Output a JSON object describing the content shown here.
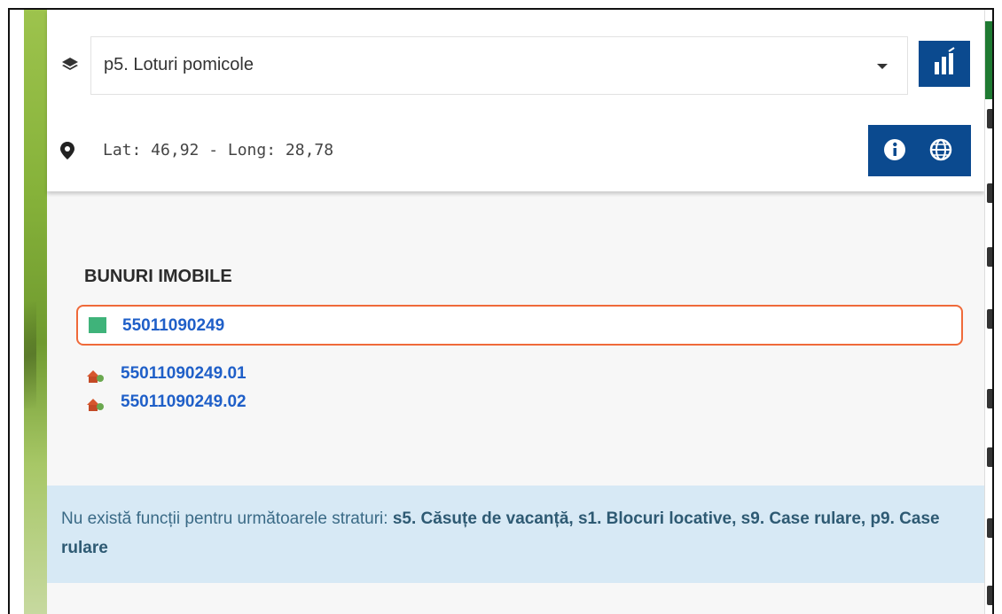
{
  "layer_selector": {
    "selected": "p5. Loturi pomicole"
  },
  "coordinates": {
    "text": "Lat: 46,92 - Long: 28,78"
  },
  "results": {
    "section_title": "BUNURI IMOBILE",
    "parcel": {
      "id": "55011090249",
      "swatch_color": "#3fb37a"
    },
    "buildings": [
      {
        "id": "55011090249.01"
      },
      {
        "id": "55011090249.02"
      }
    ]
  },
  "notice": {
    "prefix": "Nu există funcții pentru următoarele straturi:",
    "layers": "s5. Căsuțe de vacanță, s1. Blocuri locative, s9. Case rulare, p9. Case rulare"
  },
  "colors": {
    "primary_button": "#0b4a8f",
    "highlight_border": "#ef6a3a",
    "link": "#1f5fc8",
    "notice_bg": "#d7e9f5"
  }
}
